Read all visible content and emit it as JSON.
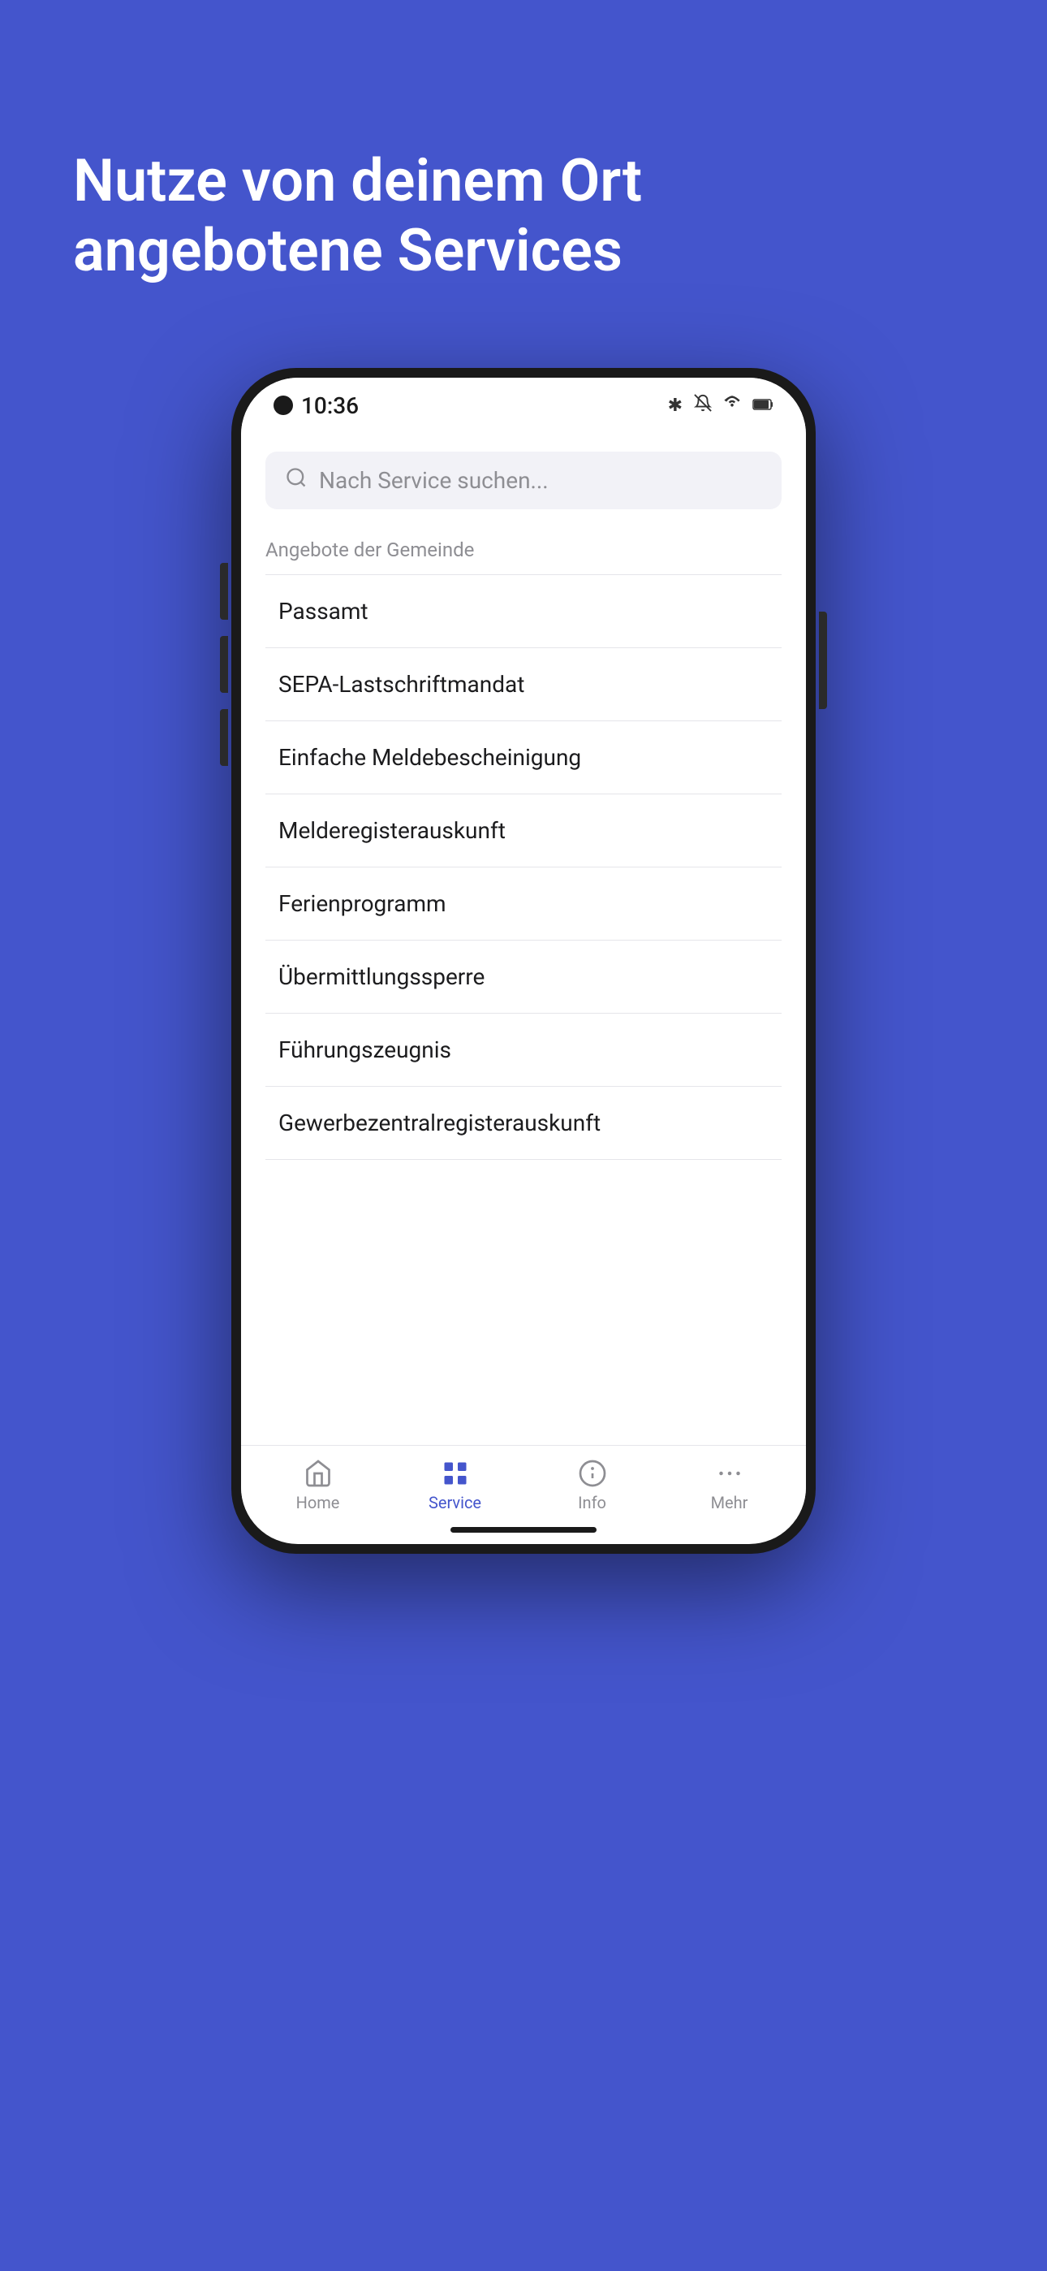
{
  "background_color": "#4455cc",
  "hero": {
    "title_line1": "Nutze von deinem Ort",
    "title_line2": "angebotene Services"
  },
  "phone": {
    "status": {
      "time": "10:36"
    },
    "search": {
      "placeholder": "Nach Service suchen..."
    },
    "section": {
      "title": "Angebote der Gemeinde"
    },
    "services": [
      {
        "name": "Passamt"
      },
      {
        "name": "SEPA-Lastschriftmandat"
      },
      {
        "name": "Einfache Meldebescheinigung"
      },
      {
        "name": "Melderegisterauskunft"
      },
      {
        "name": "Ferienprogramm"
      },
      {
        "name": "Übermittlungssperre"
      },
      {
        "name": "Führungszeugnis"
      },
      {
        "name": "Gewerbezentralregisterauskunft"
      }
    ],
    "nav": {
      "items": [
        {
          "label": "Home",
          "active": false
        },
        {
          "label": "Service",
          "active": true
        },
        {
          "label": "Info",
          "active": false
        },
        {
          "label": "Mehr",
          "active": false
        }
      ]
    }
  }
}
